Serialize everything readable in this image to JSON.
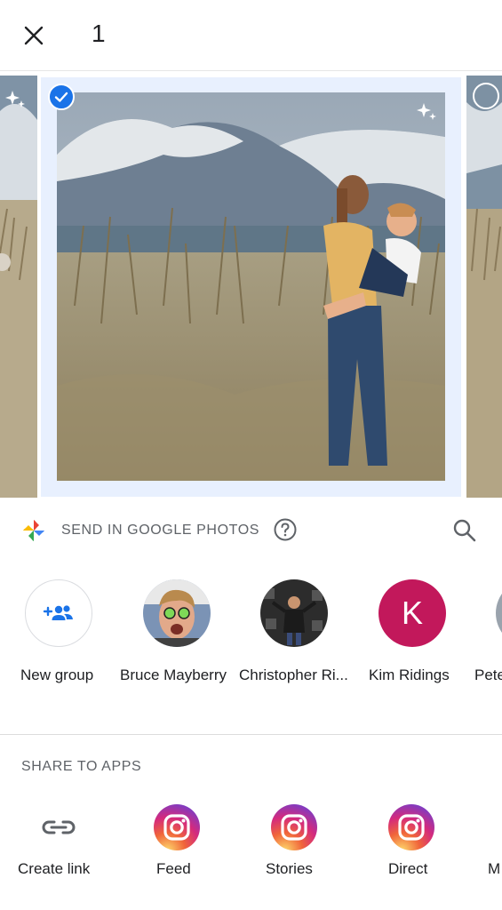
{
  "header": {
    "close_icon": "close-icon",
    "selected_count": "1"
  },
  "photos": {
    "selected_index": 1,
    "count_visible": 3
  },
  "send_section": {
    "title": "SEND IN GOOGLE PHOTOS",
    "help_icon": "help-circle-icon",
    "search_icon": "search-icon",
    "people": [
      {
        "name": "New group",
        "type": "new-group"
      },
      {
        "name": "Bruce Mayberry",
        "type": "photo"
      },
      {
        "name": "Christopher Ri...",
        "type": "photo"
      },
      {
        "name": "Kim Ridings",
        "type": "initial",
        "initial": "K",
        "color": "#c2185b"
      },
      {
        "name": "Pete",
        "type": "photo"
      }
    ]
  },
  "apps_section": {
    "title": "SHARE TO APPS",
    "apps": [
      {
        "label": "Create link",
        "icon": "link-icon"
      },
      {
        "label": "Feed",
        "icon": "instagram-icon"
      },
      {
        "label": "Stories",
        "icon": "instagram-icon"
      },
      {
        "label": "Direct",
        "icon": "instagram-icon"
      },
      {
        "label": "M",
        "icon": "app-icon"
      }
    ]
  },
  "colors": {
    "accent": "#1a73e8",
    "selection_frame": "#e8f0fe",
    "kim_avatar": "#c2185b"
  }
}
